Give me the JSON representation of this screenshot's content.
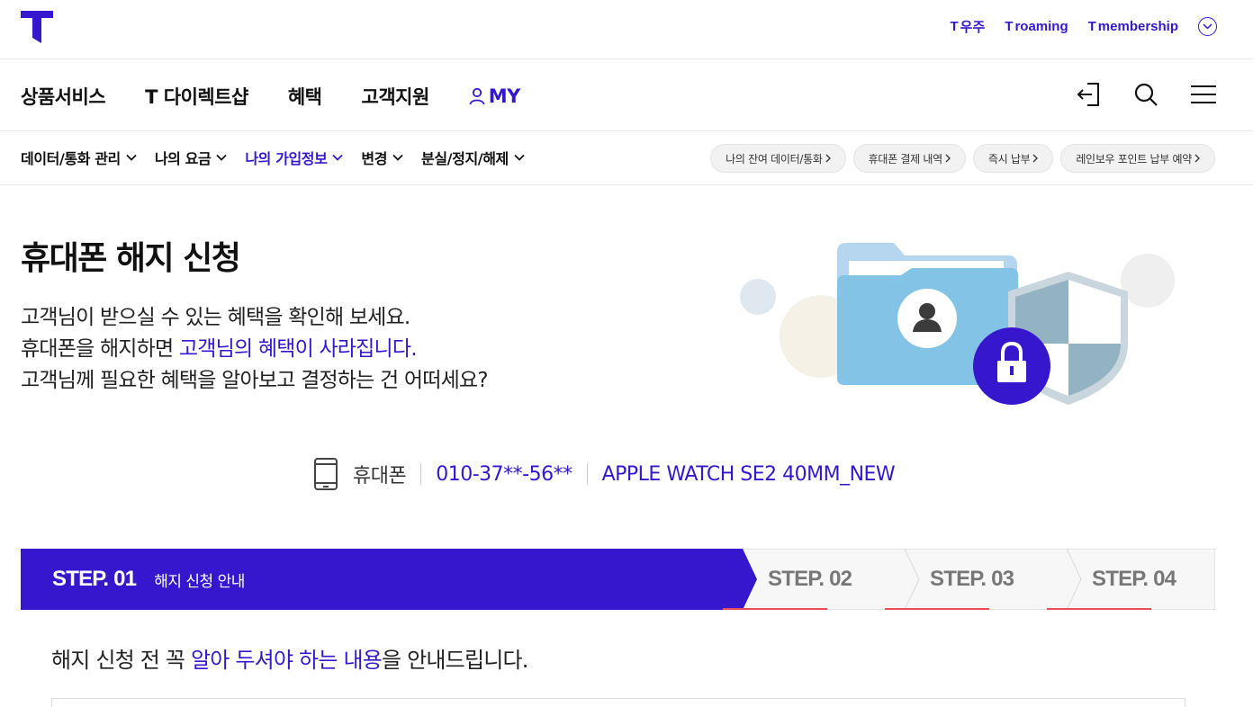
{
  "topbar": {
    "links": [
      {
        "mark": "T",
        "label": "우주"
      },
      {
        "mark": "T",
        "label": "roaming"
      },
      {
        "mark": "T",
        "label": "membership"
      }
    ]
  },
  "mainnav": {
    "items": [
      "상품서비스",
      "T 다이렉트샵",
      "혜택",
      "고객지원"
    ],
    "my_label": "MY"
  },
  "subnav": {
    "items": [
      "데이터/통화 관리",
      "나의 요금",
      "나의 가입정보",
      "변경",
      "분실/정지/해제"
    ],
    "active_index": 2,
    "chips": [
      "나의 잔여 데이터/통화",
      "휴대폰 결제 내역",
      "즉시 납부",
      "레인보우 포인트 납부 예약"
    ]
  },
  "hero": {
    "title": "휴대폰 해지 신청",
    "line1": "고객님이 받으실 수 있는 혜택을 확인해 보세요.",
    "line2_prefix": "휴대폰을 해지하면 ",
    "line2_highlight": "고객님의 혜택이 사라집니다.",
    "line3": "고객님께 필요한 혜택을 알아보고 결정하는 건 어떠세요?"
  },
  "device": {
    "type": "휴대폰",
    "number": "010-37**-56**",
    "model": "APPLE WATCH SE2 40MM_NEW"
  },
  "steps": {
    "current_num": "STEP. 01",
    "current_label": "해지 신청 안내",
    "others": [
      "STEP. 02",
      "STEP. 03",
      "STEP. 04"
    ]
  },
  "notice": {
    "prefix": "해지 신청 전 꼭 ",
    "highlight": "알아 두셔야 하는 내용",
    "suffix": "을 안내드립니다."
  },
  "colors": {
    "brand": "#3617ce",
    "step_underline": "#e84d5c"
  }
}
